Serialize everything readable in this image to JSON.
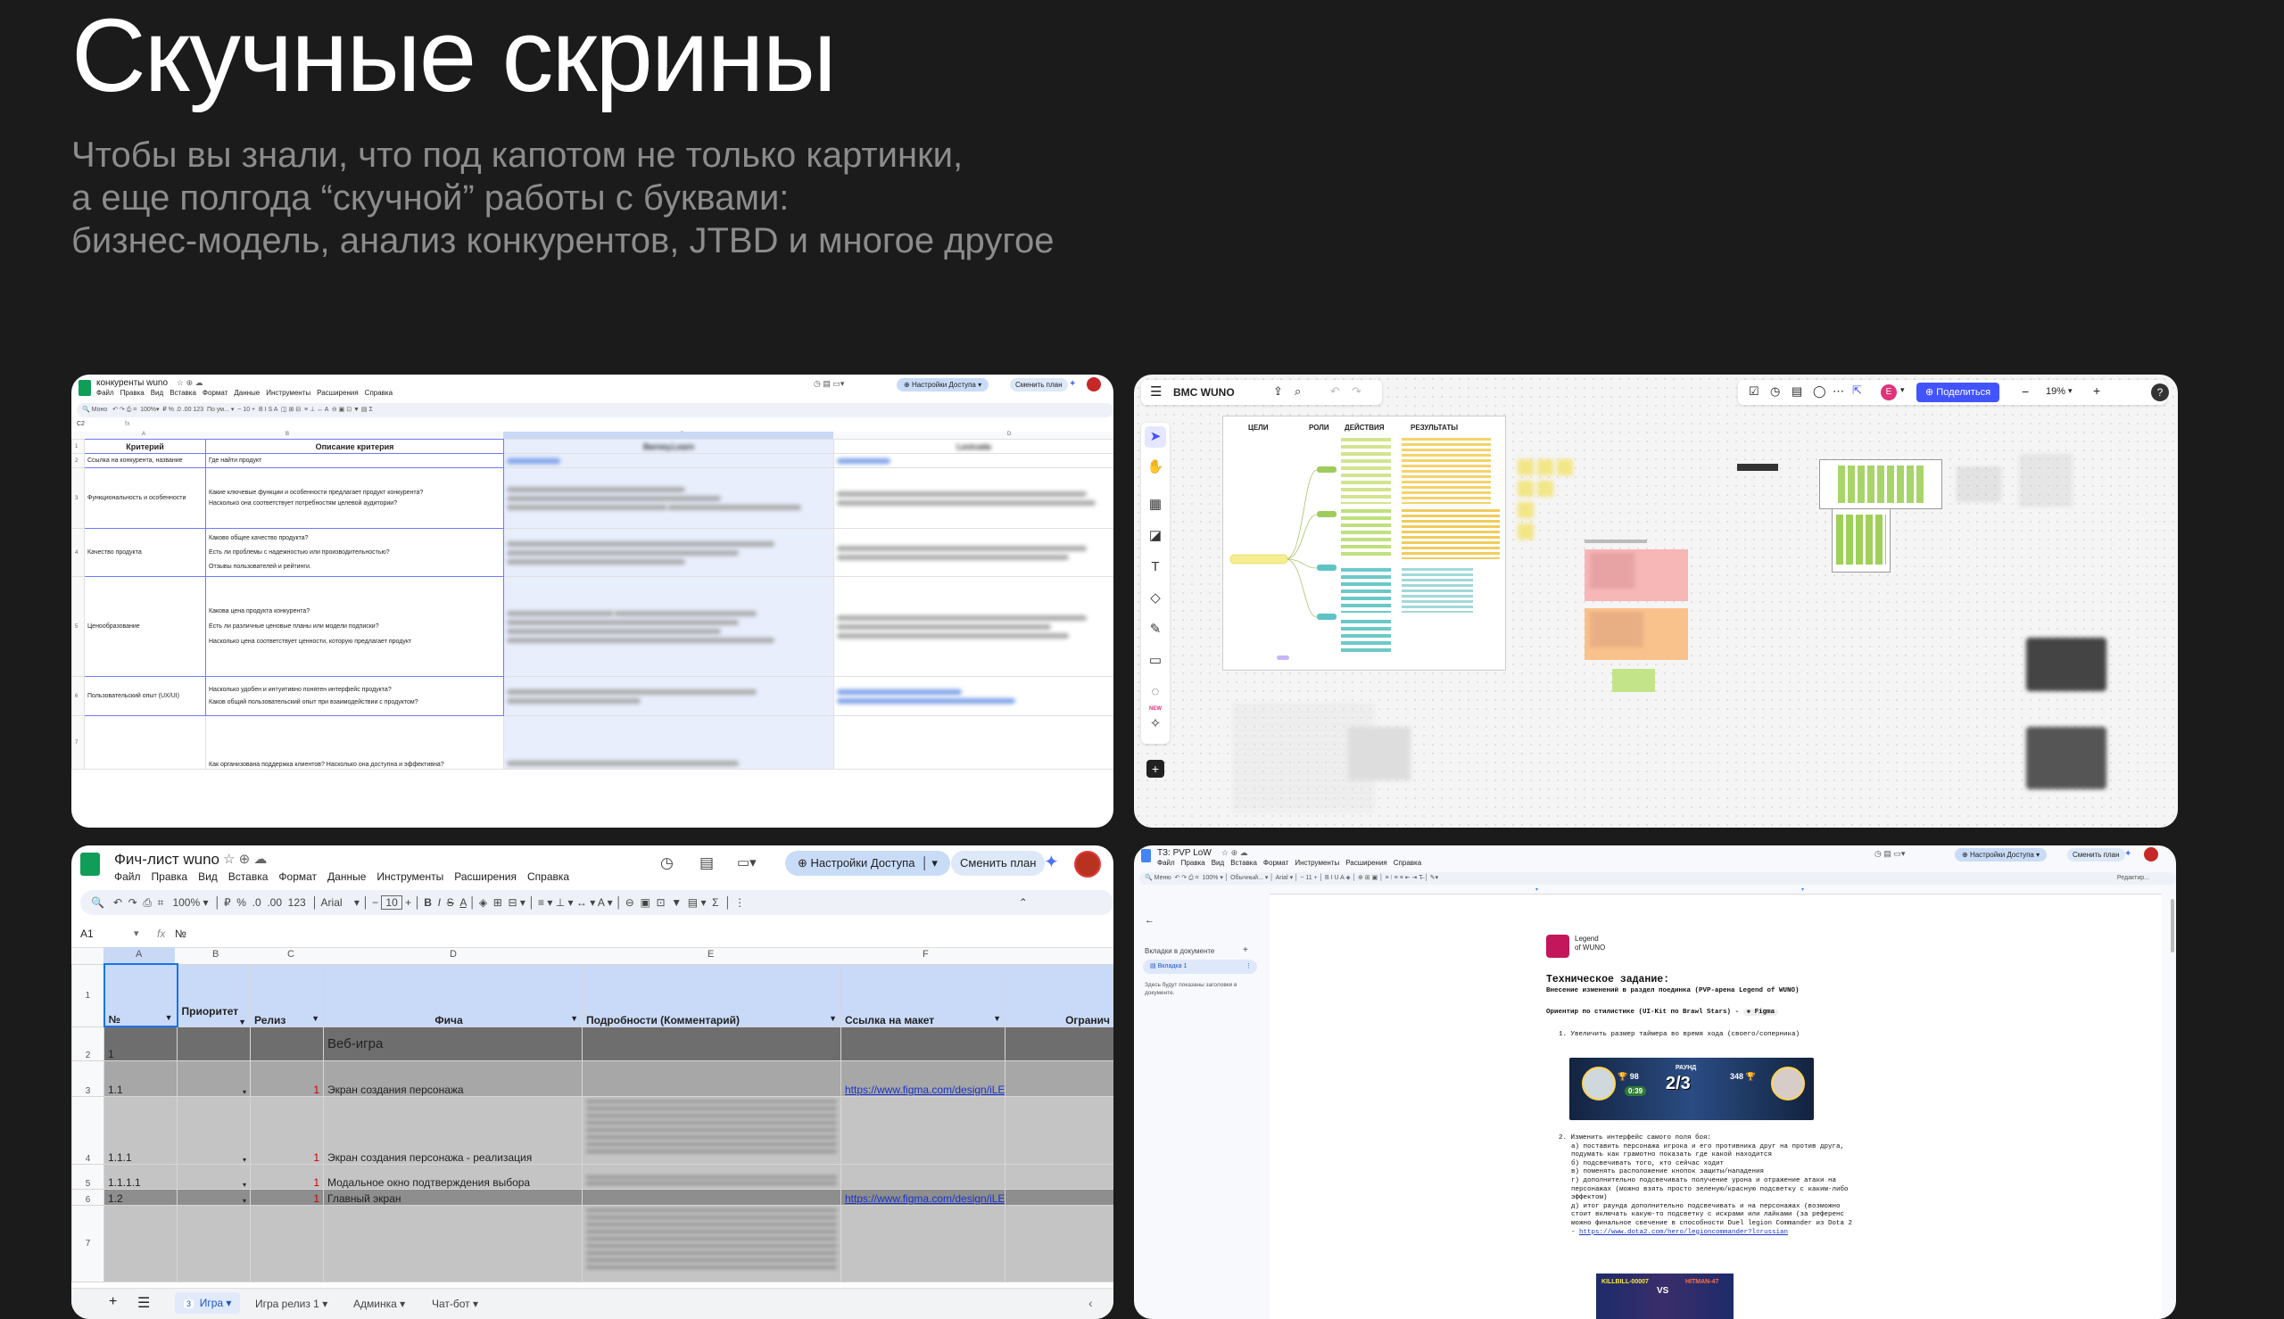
{
  "title": "Скучные скрины",
  "subtitle": [
    "Чтобы вы знали, что под капотом не только картинки,",
    "а еще полгода “скучной” работы с буквами:",
    "бизнес-модель, анализ конкурентов, JTBD и многое другое"
  ],
  "colors": {
    "background": "#1b1b1b",
    "subtitle": "#8c8c8c",
    "accent": "#1a73e8",
    "sheets_green": "#0f9d58"
  },
  "sheet1": {
    "doc_title": "конкуренты wuno",
    "menu": [
      "Файл",
      "Правка",
      "Вид",
      "Вставка",
      "Формат",
      "Данные",
      "Инструменты",
      "Расширения",
      "Справка"
    ],
    "access_button": "Настройки Доступа",
    "plan_button": "Сменить план",
    "zoom": "100%",
    "font": "Моно",
    "font_size": "10",
    "cell_ref": "C2",
    "fx": "fx",
    "columns": [
      "A",
      "B",
      "C",
      "D"
    ],
    "headers": [
      "Критерий",
      "Описание критерия",
      "Barney.Learn",
      "Lexicada"
    ],
    "rows": [
      {
        "num": "2",
        "criterion": "Ссылка на конкурента, название",
        "description": [
          "Где найти продукт"
        ]
      },
      {
        "num": "3",
        "criterion": "Функциональность и особенности",
        "description": [
          "Какие ключевые функции и особенности предлагает продукт конкурента?",
          "Насколько она соответствует потребностям целевой аудитории?"
        ]
      },
      {
        "num": "4",
        "criterion": "Качество продукта",
        "description": [
          "Каково общее качество продукта?",
          "Есть ли проблемы с надежностью или производительностью?",
          "Отзывы пользователей и рейтинги."
        ]
      },
      {
        "num": "5",
        "criterion": "Ценообразование",
        "description": [
          "Какова цена продукта конкурента?",
          "Есть ли различные ценовые планы или модели подписки?",
          "Насколько цена соответствует ценности, которую предлагает продукт"
        ]
      },
      {
        "num": "6",
        "criterion": "Пользовательский опыт (UX/UI)",
        "description": [
          "Насколько удобен и интуитивно понятен интерфейс продукта?",
          "Каков общий пользовательский опыт при взаимодействии с продуктом?"
        ]
      },
      {
        "num": "7",
        "criterion": "",
        "description": [
          "Как организована поддержка клиентов? Насколько она доступна и эффективна?"
        ]
      }
    ]
  },
  "board": {
    "title": "BMC WUNO",
    "share_button": "Поделиться",
    "zoom": "19%",
    "user_initial": "E",
    "new_badge": "NEW",
    "help": "?",
    "frame_headers": [
      "ЦЕЛИ",
      "РОЛИ",
      "ДЕЙСТВИЯ",
      "РЕЗУЛЬТАТЫ"
    ]
  },
  "sheet2": {
    "doc_title": "Фич-лист wuno",
    "menu": [
      "Файл",
      "Правка",
      "Вид",
      "Вставка",
      "Формат",
      "Данные",
      "Инструменты",
      "Расширения",
      "Справка"
    ],
    "access_button": "Настройки Доступа",
    "plan_button": "Сменить план",
    "zoom": "100%",
    "font": "Arial",
    "font_size": "10",
    "cell_ref": "A1",
    "fx": "fx",
    "formula": "№",
    "columns": [
      "A",
      "B",
      "C",
      "D",
      "E",
      "F"
    ],
    "headers": [
      "№",
      "Приоритет",
      "Релиз",
      "Фича",
      "Подробности (Комментарий)",
      "Ссылка на макет",
      "Огранич"
    ],
    "rows": [
      {
        "num": "2",
        "id": "1",
        "priority": "",
        "release": "",
        "feature": "Веб-игра",
        "link": ""
      },
      {
        "num": "3",
        "id": "1.1",
        "priority": "",
        "release": "1",
        "feature": "Экран создания персонажа",
        "link": "https://www.figma.com/design/iLEFun"
      },
      {
        "num": "4",
        "id": "1.1.1",
        "priority": "",
        "release": "1",
        "feature": "Экран создания персонажа - реализация",
        "link": ""
      },
      {
        "num": "5",
        "id": "1.1.1.1",
        "priority": "",
        "release": "1",
        "feature": "Модальное окно подтверждения выбора",
        "link": ""
      },
      {
        "num": "6",
        "id": "1.2",
        "priority": "",
        "release": "1",
        "feature": "Главный экран",
        "link": "https://www.figma.com/design/iLEFun"
      },
      {
        "num": "7",
        "id": "",
        "priority": "",
        "release": "",
        "feature": "",
        "link": ""
      }
    ],
    "tabs": [
      {
        "badge": "3",
        "label": "Игра"
      },
      {
        "label": "Игра релиз 1"
      },
      {
        "label": "Админка"
      },
      {
        "label": "Чат-бот"
      }
    ]
  },
  "doc": {
    "doc_title": "ТЗ: PVP LoW",
    "menu": [
      "Файл",
      "Правка",
      "Вид",
      "Вставка",
      "Формат",
      "Инструменты",
      "Расширения",
      "Справка"
    ],
    "access_button": "Настройки Доступа",
    "plan_button": "Сменить план",
    "style": "Обычный...",
    "font": "Arial",
    "font_size": "11",
    "editing": "Редактир...",
    "sidebar_heading": "Вкладки в документе",
    "sidebar_tab": "Вкладка 1",
    "sidebar_note": "Здесь будут показаны заголовки в документе.",
    "logo_text": [
      "Legend",
      "of WUNO"
    ],
    "heading": "Техническое задание:",
    "subheading": "Внесение изменений в раздел поединка (PVP-арена Legend of WUNO)",
    "style_ref": "Ориентир по стилистике (UI-Kit по Brawl Stars) -",
    "figma_chip": "Figma",
    "item1": "1. Увеличить размер таймера во время хода (своего/соперника)",
    "round_label": "РАУНД",
    "round_value": "2/3",
    "timer_value": "0:39",
    "score_left": "98",
    "score_right": "348",
    "item2": [
      "2. Изменить интерфейс самого поля боя:",
      "а) поставить персонажа игрока и его противника друг на против друга,",
      "подумать как грамотно показать где какой находится",
      "б) подсвечивать того, кто сейчас ходит",
      "в) поменять расположение кнопок защиты/нападения",
      "г) дополнительно подсвечивать получение урона и отражение атаки на",
      "персонажах (можно взять просто зеленую/красную подсветку с каким-либо",
      "эффектом)",
      "д) итог раунда дополнительно подсвечивать и на персонажах (возможно",
      "стоит включать какую-то подсветку с искрами или лайками (за референс",
      "можно финальное свечение в способности Duel legion Commander  из Dota 2"
    ],
    "link": "https://www.dota2.com/hero/legioncommander?l=russian",
    "vs_left": "KILLBILL-00007",
    "vs_middle": "VS",
    "vs_right": "HITMAN-47"
  }
}
